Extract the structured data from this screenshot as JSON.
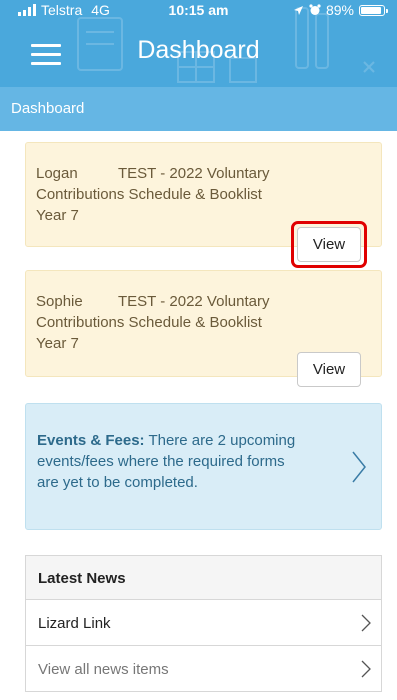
{
  "status_bar": {
    "carrier": "Telstra",
    "network": "4G",
    "time": "10:15 am",
    "battery": "89%",
    "battery_level": 0.89
  },
  "header": {
    "title": "Dashboard",
    "menu_icon": "hamburger-menu-icon"
  },
  "breadcrumb": "Dashboard",
  "cards": [
    {
      "name": "Logan",
      "line1": "TEST - 2022 Voluntary",
      "line2": "Contributions Schedule & Booklist",
      "line3": "Year 7",
      "button": "View",
      "highlighted": true
    },
    {
      "name": "Sophie",
      "line1": "TEST - 2022 Voluntary",
      "line2": "Contributions Schedule & Booklist",
      "line3": "Year 7",
      "button": "View",
      "highlighted": false
    }
  ],
  "events": {
    "heading": "Events & Fees:",
    "body": "There are 2 upcoming events/fees where the required forms are yet to be completed.",
    "icon": "chevron-right-icon"
  },
  "news": {
    "heading": "Latest News",
    "items": [
      {
        "label": "Lizard Link",
        "color": "#222222"
      },
      {
        "label": "View all news items",
        "color": "#777777"
      }
    ]
  },
  "colors": {
    "header": "#4aa8dc",
    "breadcrumb": "#65b6e4",
    "card_bg": "#fdf4dc",
    "events_bg": "#d9edf7",
    "highlight": "#e00000"
  }
}
